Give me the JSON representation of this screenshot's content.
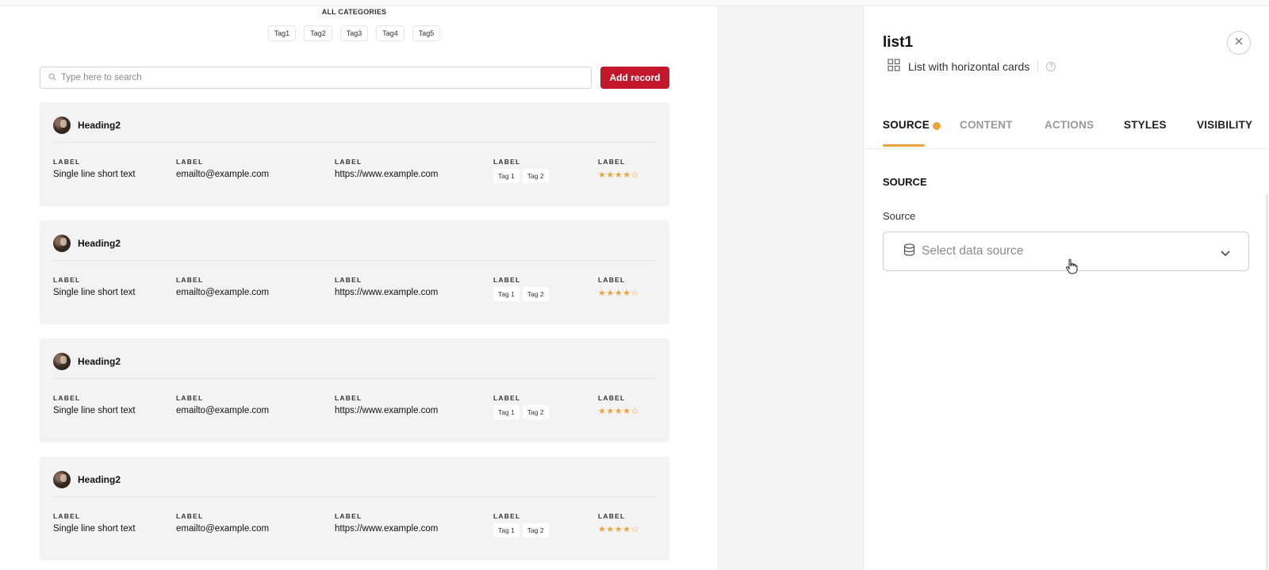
{
  "preview": {
    "categories_title": "ALL CATEGORIES",
    "category_tags": [
      "Tag1",
      "Tag2",
      "Tag3",
      "Tag4",
      "Tag5"
    ],
    "search_placeholder": "Type here to search",
    "add_button": "Add record",
    "cards": [
      {
        "heading": "Heading2",
        "fields": [
          {
            "label": "LABEL",
            "value": "Single line short text"
          },
          {
            "label": "LABEL",
            "value": "emailto@example.com"
          },
          {
            "label": "LABEL",
            "value": "https://www.example.com"
          },
          {
            "label": "LABEL",
            "tags": [
              "Tag 1",
              "Tag 2"
            ]
          },
          {
            "label": "LABEL",
            "rating": 4,
            "rating_max": 5
          }
        ]
      },
      {
        "heading": "Heading2",
        "fields": [
          {
            "label": "LABEL",
            "value": "Single line short text"
          },
          {
            "label": "LABEL",
            "value": "emailto@example.com"
          },
          {
            "label": "LABEL",
            "value": "https://www.example.com"
          },
          {
            "label": "LABEL",
            "tags": [
              "Tag 1",
              "Tag 2"
            ]
          },
          {
            "label": "LABEL",
            "rating": 4,
            "rating_max": 5
          }
        ]
      },
      {
        "heading": "Heading2",
        "fields": [
          {
            "label": "LABEL",
            "value": "Single line short text"
          },
          {
            "label": "LABEL",
            "value": "emailto@example.com"
          },
          {
            "label": "LABEL",
            "value": "https://www.example.com"
          },
          {
            "label": "LABEL",
            "tags": [
              "Tag 1",
              "Tag 2"
            ]
          },
          {
            "label": "LABEL",
            "rating": 4,
            "rating_max": 5
          }
        ]
      },
      {
        "heading": "Heading2",
        "fields": [
          {
            "label": "LABEL",
            "value": "Single line short text"
          },
          {
            "label": "LABEL",
            "value": "emailto@example.com"
          },
          {
            "label": "LABEL",
            "value": "https://www.example.com"
          },
          {
            "label": "LABEL",
            "tags": [
              "Tag 1",
              "Tag 2"
            ]
          },
          {
            "label": "LABEL",
            "rating": 4,
            "rating_max": 5
          }
        ]
      }
    ]
  },
  "panel": {
    "title": "list1",
    "component_type": "List with horizontal cards",
    "tabs": [
      {
        "label": "SOURCE",
        "active": true,
        "has_indicator": true
      },
      {
        "label": "CONTENT",
        "active": false
      },
      {
        "label": "ACTIONS",
        "active": false
      },
      {
        "label": "STYLES",
        "active": false
      },
      {
        "label": "VISIBILITY",
        "active": false
      }
    ],
    "section_title": "SOURCE",
    "source_label": "Source",
    "source_placeholder": "Select data source"
  },
  "colors": {
    "accent": "#f0a33a",
    "add_button": "#c3172c",
    "card_bg": "#f3f3f3",
    "preview_gutter": "#f3f3f4"
  },
  "icons": [
    "search-icon",
    "close-icon",
    "grid-icon",
    "help-icon",
    "database-icon",
    "chevron-down-icon",
    "star-icon",
    "pointer-cursor-icon"
  ]
}
